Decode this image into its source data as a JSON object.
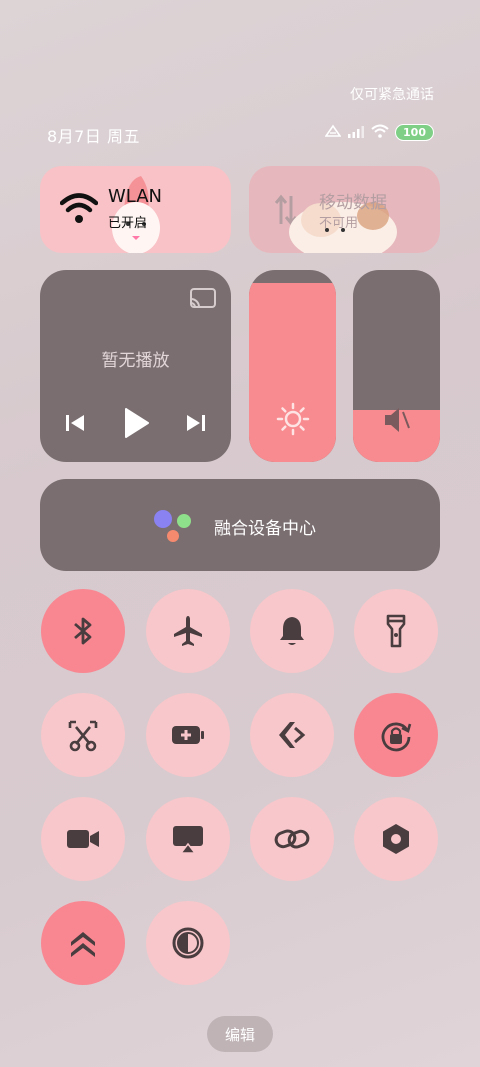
{
  "status_bar": {
    "emergency_text": "仅可紧急通话",
    "date": "8月7日 周五",
    "battery": "100"
  },
  "tiles": {
    "wlan": {
      "title": "WLAN",
      "subtitle": "已开启"
    },
    "mobile": {
      "title": "移动数据",
      "subtitle": "不可用"
    }
  },
  "media": {
    "status": "暂无播放"
  },
  "sliders": {
    "brightness_level": 0.93,
    "volume_level": 0.27
  },
  "fusion": {
    "label": "融合设备中心"
  },
  "toggles": [
    {
      "name": "bluetooth",
      "icon": "bluetooth-icon",
      "on": true
    },
    {
      "name": "airplane",
      "icon": "airplane-icon",
      "on": false
    },
    {
      "name": "bell",
      "icon": "bell-icon",
      "on": false
    },
    {
      "name": "flashlight",
      "icon": "flashlight-icon",
      "on": false
    },
    {
      "name": "screenshot",
      "icon": "scissors-icon",
      "on": false
    },
    {
      "name": "battery-saver",
      "icon": "battery-plus-icon",
      "on": false
    },
    {
      "name": "nearby-share",
      "icon": "share-arrow-icon",
      "on": false
    },
    {
      "name": "rotation-lock",
      "icon": "rotation-lock-icon",
      "on": true
    },
    {
      "name": "screen-record",
      "icon": "video-camera-icon",
      "on": false
    },
    {
      "name": "screen-cast",
      "icon": "cast-screen-icon",
      "on": false
    },
    {
      "name": "link",
      "icon": "link-icon",
      "on": false
    },
    {
      "name": "settings",
      "icon": "hexagon-settings-icon",
      "on": false
    },
    {
      "name": "performance",
      "icon": "chevrons-up-icon",
      "on": true
    },
    {
      "name": "dark-mode",
      "icon": "contrast-icon",
      "on": false
    }
  ],
  "edit_button": "编辑"
}
